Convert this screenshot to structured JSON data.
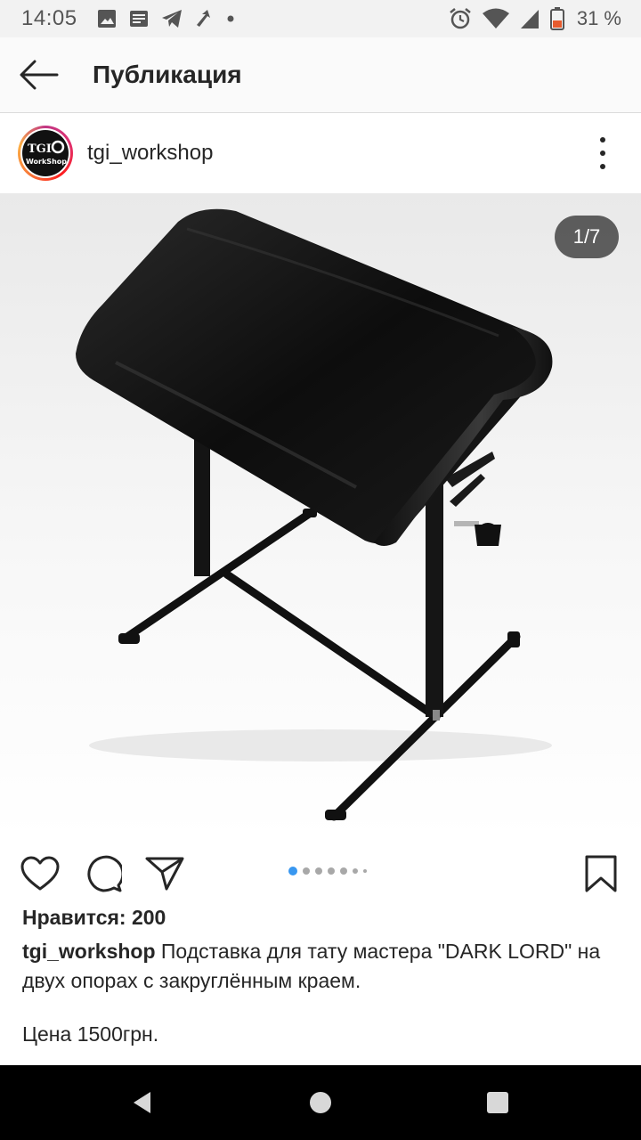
{
  "status_bar": {
    "time": "14:05",
    "battery_text": "31 %",
    "icons": [
      "image-icon",
      "news-icon",
      "telegram-icon",
      "arrow-icon",
      "dot-icon",
      "alarm-icon",
      "wifi-icon",
      "signal-icon",
      "battery-icon"
    ]
  },
  "app_bar": {
    "title": "Публикация",
    "back_icon": "back-arrow-icon"
  },
  "post": {
    "username": "tgi_workshop",
    "avatar_text_1": "TGI",
    "avatar_text_2": "WorkShop",
    "counter": "1/7",
    "likes": "Нравится: 200",
    "caption_user": "tgi_workshop",
    "caption_text": " Подставка для тату мастера \"DARK LORD\" на двух опорах с закруглённым краем.",
    "price": "Цена 1500грн.",
    "carousel": {
      "total": 7,
      "active": 1
    }
  },
  "actions": {
    "icons": [
      "heart-icon",
      "comment-icon",
      "share-icon",
      "bookmark-icon"
    ]
  },
  "nav_bar": {
    "icons": [
      "nav-back-icon",
      "nav-home-icon",
      "nav-recents-icon"
    ]
  }
}
